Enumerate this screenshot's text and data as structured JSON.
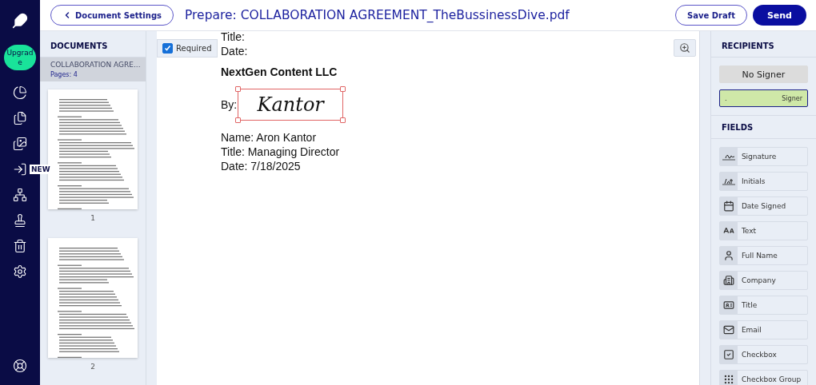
{
  "header": {
    "back_button": "Document Settings",
    "title": "Prepare: COLLABORATION AGREEMENT_TheBussinessDive.pdf",
    "save_button": "Save Draft",
    "send_button": "Send"
  },
  "sidebar": {
    "upgrade_label": "Upgrade",
    "new_badge": "NEW"
  },
  "documents": {
    "heading": "DOCUMENTS",
    "current": {
      "name": "COLLABORATION AGRE...",
      "pages": "Pages: 4"
    },
    "thumbnails": [
      {
        "label": "1"
      },
      {
        "label": "2"
      }
    ]
  },
  "required": {
    "label": "Required",
    "checked": true
  },
  "document": {
    "lines": [
      {
        "kind": "text",
        "text": "Title:"
      },
      {
        "kind": "text",
        "text": "Date:"
      },
      {
        "kind": "heading",
        "text": "NextGen Content LLC"
      },
      {
        "kind": "signature",
        "label": "By:",
        "text": "Kantor"
      },
      {
        "kind": "text",
        "text": "Name: Aron Kantor"
      },
      {
        "kind": "text",
        "text": "Title: Managing Director"
      },
      {
        "kind": "text",
        "text": "Date: 7/18/2025"
      }
    ]
  },
  "recipients": {
    "heading": "RECIPIENTS",
    "items": [
      {
        "name": "No Signer",
        "selected": false
      },
      {
        "name": ".",
        "role": "Signer",
        "selected": true
      }
    ]
  },
  "fields": {
    "heading": "FIELDS",
    "items": [
      {
        "label": "Signature"
      },
      {
        "label": "Initials"
      },
      {
        "label": "Date Signed"
      },
      {
        "label": "Text"
      },
      {
        "label": "Full Name"
      },
      {
        "label": "Company"
      },
      {
        "label": "Title"
      },
      {
        "label": "Email"
      },
      {
        "label": "Checkbox"
      },
      {
        "label": "Checkbox Group"
      }
    ]
  }
}
